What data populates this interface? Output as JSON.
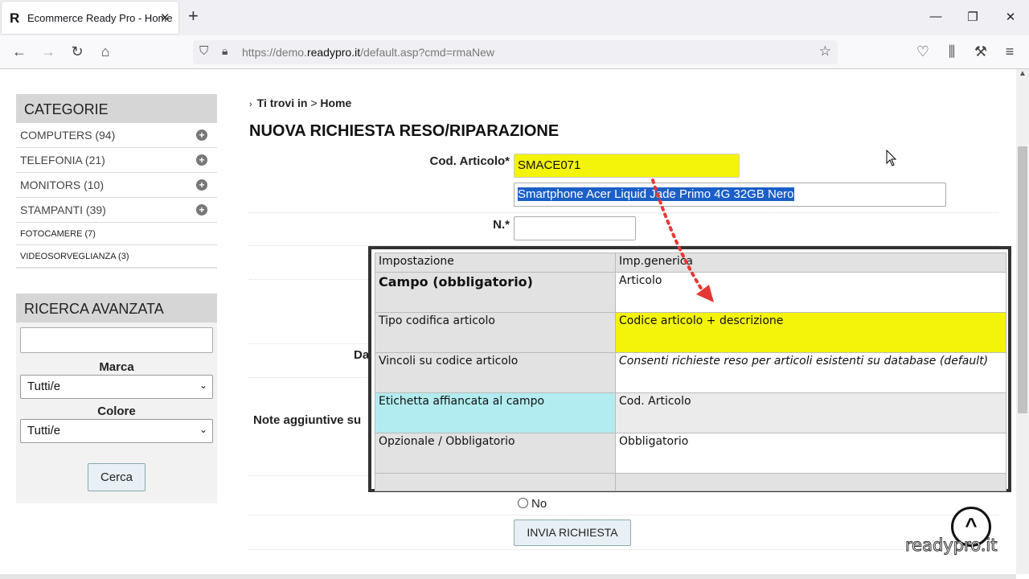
{
  "browser": {
    "tab_title": "Ecommerce Ready Pro - Home",
    "favicon": "R",
    "url_prefix": "https://demo.",
    "url_host": "readypro.it",
    "url_path": "/default.asp?cmd=rmaNew"
  },
  "sidebar": {
    "categories_title": "CATEGORIE",
    "categories": [
      {
        "label": "COMPUTERS (94)"
      },
      {
        "label": "TELEFONIA (21)"
      },
      {
        "label": "MONITORS (10)"
      },
      {
        "label": "STAMPANTI (39)"
      },
      {
        "label": "FOTOCAMERE (7)"
      },
      {
        "label": "VIDEOSORVEGLIANZA (3)"
      }
    ],
    "search_title": "RICERCA AVANZATA",
    "brand_label": "Marca",
    "brand_value": "Tutti/e",
    "color_label": "Colore",
    "color_value": "Tutti/e",
    "search_button": "Cerca"
  },
  "main": {
    "breadcrumb_prefix": "Ti trovi in",
    "breadcrumb_sep": ">",
    "breadcrumb_home": "Home",
    "title": "NUOVA RICHIESTA RESO/RIPARAZIONE",
    "cod_label": "Cod. Articolo*",
    "cod_value": "SMACE071",
    "description_value": "Smartphone Acer Liquid Jade Primo 4G 32GB Nero",
    "n_label": "N.*",
    "partial_label_da": "Da",
    "partial_label_note": "Note aggiuntive su",
    "radio_no": "No",
    "submit_button": "INVIA RICHIESTA"
  },
  "overlay": {
    "header_left": "Impostazione",
    "header_right": "Imp.generica",
    "rows": [
      {
        "left": "Campo (obbligatorio)",
        "right": "Articolo"
      },
      {
        "left": "Tipo codifica articolo",
        "right": "Codice articolo + descrizione"
      },
      {
        "left": "Vincoli su codice articolo",
        "right": "Consenti richieste reso per articoli esistenti su database (default)"
      },
      {
        "left": "Etichetta affiancata al campo",
        "right": "Cod. Articolo"
      },
      {
        "left": "Opzionale / Obbligatorio",
        "right": "Obbligatorio"
      }
    ]
  },
  "watermark": {
    "text": "readypro.it",
    "symbol": "^"
  },
  "colors": {
    "highlight_yellow": "#f4f40a",
    "highlight_cyan": "#b2ecf0",
    "arrow_red": "#e53935",
    "selection_blue": "#1b5fc8"
  }
}
